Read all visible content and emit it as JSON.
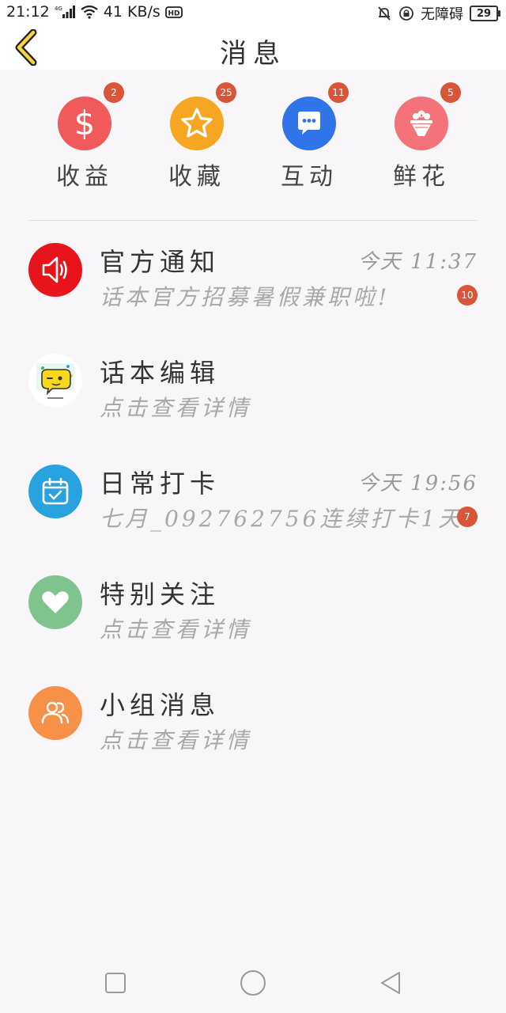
{
  "status_bar": {
    "time": "21:12",
    "network_type": "4G",
    "speed": "41 KB/s",
    "hd_label": "HD",
    "accessibility": "无障碍",
    "battery": "29"
  },
  "header": {
    "title": "消息",
    "back_icon": "chevron-left-icon"
  },
  "shortcuts": [
    {
      "label": "收益",
      "badge": "2",
      "icon": "dollar-icon",
      "color": "#f05a5a"
    },
    {
      "label": "收藏",
      "badge": "25",
      "icon": "star-icon",
      "color": "#f7a623"
    },
    {
      "label": "互动",
      "badge": "11",
      "icon": "chat-icon",
      "color": "#2f74e8"
    },
    {
      "label": "鲜花",
      "badge": "5",
      "icon": "flower-bouquet-icon",
      "color": "#f4727a"
    }
  ],
  "messages": [
    {
      "title": "官方通知",
      "time": "今天 11:37",
      "preview": "话本官方招募暑假兼职啦!",
      "badge": "10",
      "icon": "speaker-icon",
      "color": "#e8141b"
    },
    {
      "title": "话本编辑",
      "time": "",
      "preview": "点击查看详情",
      "badge": "",
      "icon": "editor-avatar-icon",
      "color": "#ffffff"
    },
    {
      "title": "日常打卡",
      "time": "今天 19:56",
      "preview": "七月_092762756连续打卡1天",
      "badge": "7",
      "icon": "calendar-check-icon",
      "color": "#29a3e0"
    },
    {
      "title": "特别关注",
      "time": "",
      "preview": "点击查看详情",
      "badge": "",
      "icon": "heart-icon",
      "color": "#7fc48e"
    },
    {
      "title": "小组消息",
      "time": "",
      "preview": "点击查看详情",
      "badge": "",
      "icon": "group-icon",
      "color": "#f7914a"
    }
  ],
  "nav": {
    "recent_icon": "square-icon",
    "home_icon": "circle-icon",
    "back_icon": "triangle-back-icon"
  }
}
